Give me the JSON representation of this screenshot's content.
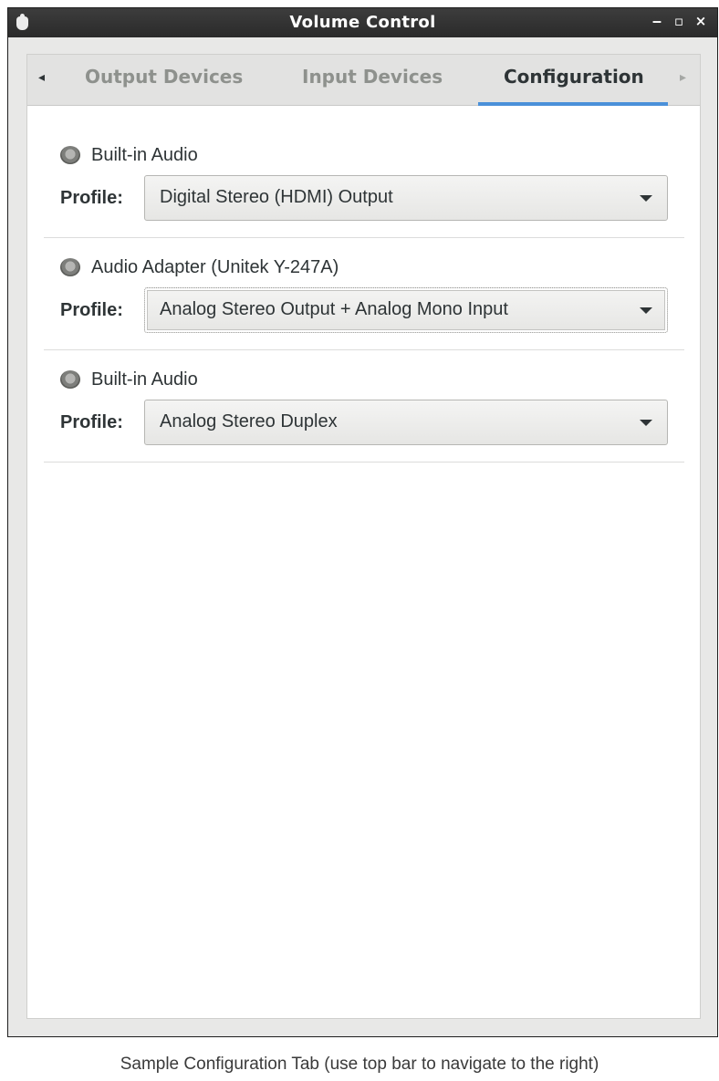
{
  "window": {
    "title": "Volume Control",
    "minimize_glyph": "‒",
    "maximize_glyph": "▫",
    "close_glyph": "×"
  },
  "tabs": [
    {
      "label": "Output Devices",
      "active": false
    },
    {
      "label": "Input Devices",
      "active": false
    },
    {
      "label": "Configuration",
      "active": true
    }
  ],
  "tab_nav": {
    "left_glyph": "◂",
    "right_glyph": "▸"
  },
  "devices": [
    {
      "icon": "speaker-icon",
      "name": "Built-in Audio",
      "profile_label": "Profile:",
      "profile_value": "Digital Stereo (HDMI) Output"
    },
    {
      "icon": "speaker-icon",
      "name": "Audio Adapter (Unitek Y-247A)",
      "profile_label": "Profile:",
      "profile_value": "Analog Stereo Output + Analog Mono Input"
    },
    {
      "icon": "speaker-icon",
      "name": "Built-in Audio",
      "profile_label": "Profile:",
      "profile_value": "Analog Stereo Duplex"
    }
  ],
  "caption": "Sample Configuration Tab (use top bar to navigate to the right)",
  "colors": {
    "accent": "#4a90d9",
    "titlebar": "#333333",
    "inactive_tab": "#8e918d"
  }
}
